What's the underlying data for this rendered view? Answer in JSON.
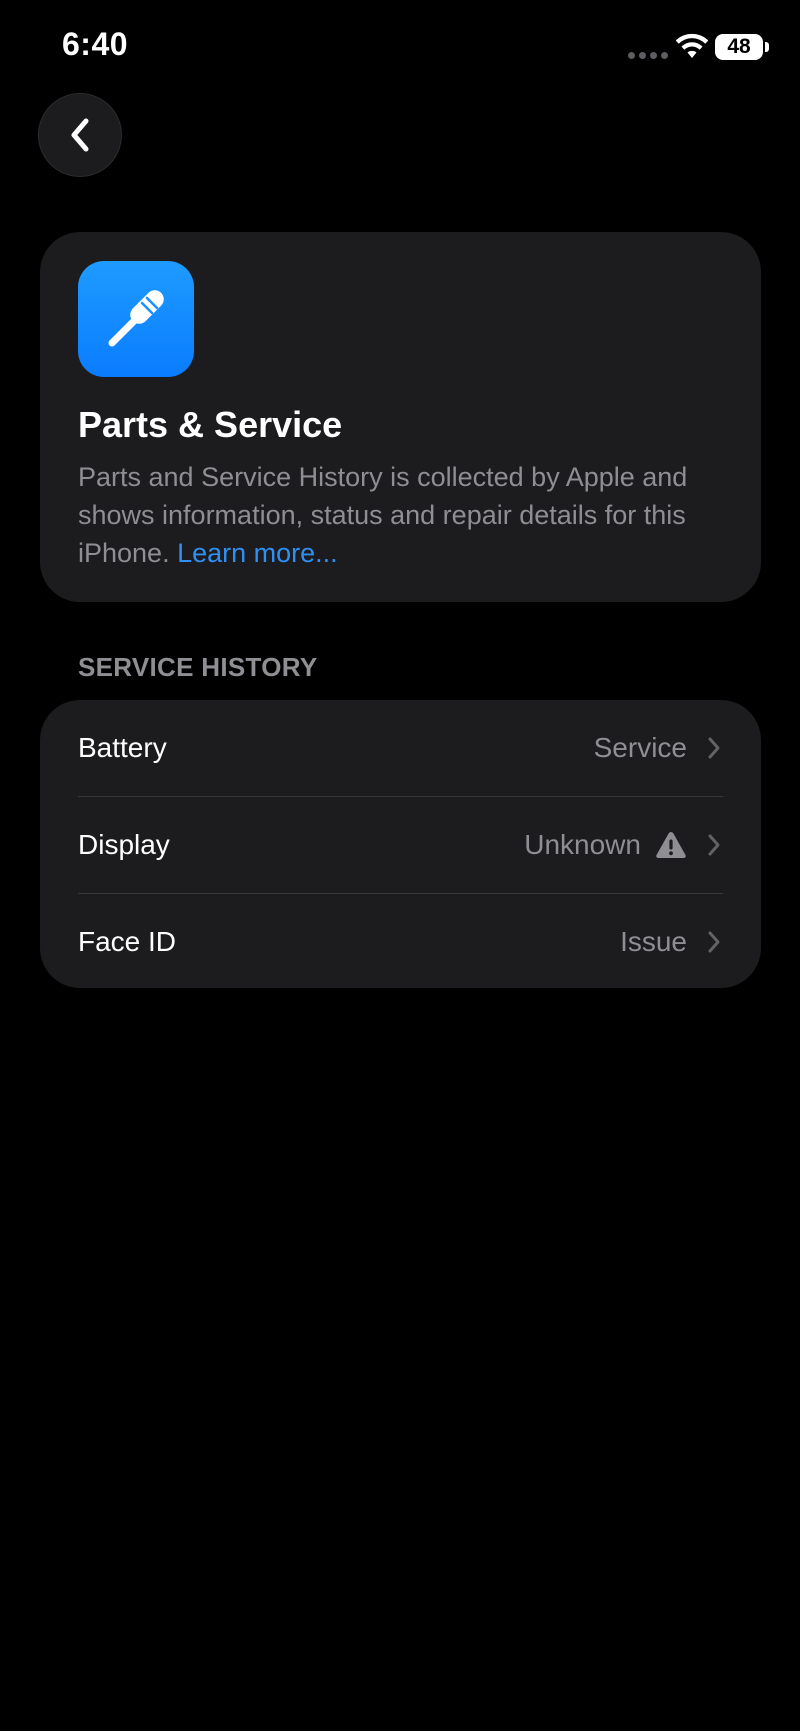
{
  "status_bar": {
    "time": "6:40",
    "battery_level": "48",
    "wifi_icon": "wifi-icon",
    "signal_icon": "signal-dots-icon"
  },
  "nav": {
    "back_icon": "chevron-left-icon"
  },
  "header_card": {
    "icon": "screwdriver-icon",
    "icon_color": "#0a84ff",
    "title": "Parts & Service",
    "description": "Parts and Service History is collected by Apple and shows information, status and repair details for this iPhone.",
    "learn_more": "Learn more..."
  },
  "service_history": {
    "section_title": "SERVICE HISTORY",
    "items": [
      {
        "label": "Battery",
        "value": "Service",
        "icon": "chevron-right-icon"
      },
      {
        "label": "Display",
        "value": "Unknown",
        "warning_icon": "warning-triangle-icon",
        "icon": "chevron-right-icon"
      },
      {
        "label": "Face ID",
        "value": "Issue",
        "icon": "chevron-right-icon"
      }
    ]
  },
  "colors": {
    "background": "#000000",
    "card": "#1c1c1e",
    "secondary_text": "#8e8e93",
    "link": "#2f8ff3",
    "separator": "#38383a"
  }
}
